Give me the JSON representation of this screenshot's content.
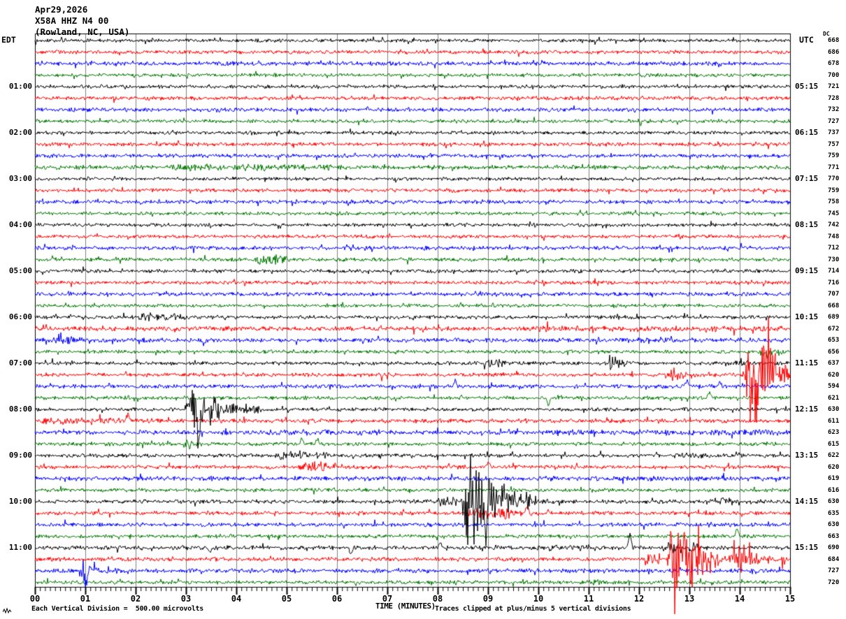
{
  "title": {
    "date": "Apr29,2026",
    "station": "X58A HHZ N4 00",
    "location": "(Rowland, NC, USA)"
  },
  "axes": {
    "left_header": "EDT",
    "right_header": "UTC",
    "dc_header": "DC",
    "x_title": "TIME (MINUTES)",
    "x_tick_labels": [
      "00",
      "01",
      "02",
      "03",
      "04",
      "05",
      "06",
      "07",
      "08",
      "09",
      "10",
      "11",
      "12",
      "13",
      "14",
      "15"
    ]
  },
  "footer": {
    "left": "Each Vertical Division =  500.00 microvolts",
    "right": "Traces clipped at plus/minus 5 vertical divisions"
  },
  "colors": {
    "trace_cycle": [
      "#000000",
      "#ff0000",
      "#0000ff",
      "#007700"
    ],
    "grid": "#808080",
    "border": "#000000",
    "background": "#ffffff"
  },
  "chart_data": {
    "type": "line",
    "x_range_minutes": [
      0,
      15
    ],
    "minutes_per_row": 15,
    "clip_divisions": 5,
    "microvolts_per_division": 500,
    "rows": [
      {
        "edt": "",
        "utc": "",
        "dc": 668,
        "amp": 1.7,
        "events": []
      },
      {
        "edt": "",
        "utc": "",
        "dc": 686,
        "amp": 1.8,
        "events": []
      },
      {
        "edt": "",
        "utc": "",
        "dc": 678,
        "amp": 2.0,
        "events": []
      },
      {
        "edt": "",
        "utc": "",
        "dc": 700,
        "amp": 1.8,
        "events": []
      },
      {
        "edt": "01:00",
        "utc": "05:15",
        "dc": 721,
        "amp": 1.7,
        "events": []
      },
      {
        "edt": "",
        "utc": "",
        "dc": 728,
        "amp": 1.9,
        "events": []
      },
      {
        "edt": "",
        "utc": "",
        "dc": 732,
        "amp": 2.0,
        "events": []
      },
      {
        "edt": "",
        "utc": "",
        "dc": 727,
        "amp": 1.8,
        "events": []
      },
      {
        "edt": "02:00",
        "utc": "06:15",
        "dc": 737,
        "amp": 1.7,
        "events": []
      },
      {
        "edt": "",
        "utc": "",
        "dc": 757,
        "amp": 1.8,
        "events": []
      },
      {
        "edt": "",
        "utc": "",
        "dc": 759,
        "amp": 1.9,
        "events": []
      },
      {
        "edt": "",
        "utc": "",
        "dc": 771,
        "amp": 2.2,
        "events": [
          [
            2.6,
            6.4,
            3.4,
            "noise"
          ]
        ]
      },
      {
        "edt": "03:00",
        "utc": "07:15",
        "dc": 770,
        "amp": 1.7,
        "events": []
      },
      {
        "edt": "",
        "utc": "",
        "dc": 759,
        "amp": 1.8,
        "events": []
      },
      {
        "edt": "",
        "utc": "",
        "dc": 758,
        "amp": 1.9,
        "events": []
      },
      {
        "edt": "",
        "utc": "",
        "dc": 745,
        "amp": 1.7,
        "events": []
      },
      {
        "edt": "04:00",
        "utc": "08:15",
        "dc": 742,
        "amp": 1.7,
        "events": []
      },
      {
        "edt": "",
        "utc": "",
        "dc": 748,
        "amp": 1.8,
        "events": []
      },
      {
        "edt": "",
        "utc": "",
        "dc": 712,
        "amp": 1.9,
        "events": []
      },
      {
        "edt": "",
        "utc": "",
        "dc": 730,
        "amp": 1.8,
        "events": [
          [
            4.3,
            5.1,
            5,
            "noise"
          ]
        ]
      },
      {
        "edt": "05:00",
        "utc": "09:15",
        "dc": 714,
        "amp": 1.7,
        "events": []
      },
      {
        "edt": "",
        "utc": "",
        "dc": 716,
        "amp": 1.8,
        "events": []
      },
      {
        "edt": "",
        "utc": "",
        "dc": 707,
        "amp": 1.9,
        "events": []
      },
      {
        "edt": "",
        "utc": "",
        "dc": 668,
        "amp": 1.7,
        "events": []
      },
      {
        "edt": "06:00",
        "utc": "10:15",
        "dc": 689,
        "amp": 1.8,
        "events": [
          [
            2.0,
            3.05,
            4.5,
            "noise"
          ]
        ]
      },
      {
        "edt": "",
        "utc": "",
        "dc": 672,
        "amp": 2.2,
        "events": [
          [
            9.5,
            15,
            3,
            "noise"
          ]
        ]
      },
      {
        "edt": "",
        "utc": "",
        "dc": 653,
        "amp": 2.2,
        "events": [
          [
            0.3,
            1.1,
            4,
            "noise"
          ],
          [
            3.35,
            3.35,
            -7,
            "spike"
          ]
        ]
      },
      {
        "edt": "",
        "utc": "",
        "dc": 656,
        "amp": 1.7,
        "events": [
          [
            14.3,
            15,
            4,
            "noise"
          ]
        ]
      },
      {
        "edt": "07:00",
        "utc": "11:15",
        "dc": 637,
        "amp": 1.8,
        "events": [
          [
            8.85,
            9.75,
            6,
            "burst"
          ],
          [
            11.35,
            11.95,
            9,
            "burst"
          ],
          [
            13.8,
            14.3,
            3,
            "noise"
          ]
        ]
      },
      {
        "edt": "",
        "utc": "",
        "dc": 620,
        "amp": 1.8,
        "events": [
          [
            6.8,
            7.3,
            6,
            "burst"
          ],
          [
            12.55,
            13.3,
            9,
            "burst"
          ],
          [
            14.05,
            15,
            60,
            "burst"
          ]
        ]
      },
      {
        "edt": "",
        "utc": "",
        "dc": 594,
        "amp": 2.0,
        "events": [
          [
            8.35,
            8.35,
            8,
            "spike"
          ],
          [
            12.95,
            12.95,
            9,
            "spike"
          ],
          [
            13.6,
            13.6,
            7,
            "spike"
          ]
        ]
      },
      {
        "edt": "",
        "utc": "",
        "dc": 621,
        "amp": 1.8,
        "events": [
          [
            10.2,
            10.2,
            -12,
            "spike"
          ],
          [
            13.4,
            13.4,
            10,
            "spike"
          ]
        ]
      },
      {
        "edt": "08:00",
        "utc": "12:15",
        "dc": 630,
        "amp": 1.8,
        "events": [
          [
            2.95,
            4.05,
            28,
            "burst"
          ],
          [
            3.25,
            3.25,
            -48,
            "spike"
          ],
          [
            4.05,
            4.6,
            5,
            "noise"
          ]
        ]
      },
      {
        "edt": "",
        "utc": "",
        "dc": 611,
        "amp": 2.0,
        "events": [
          [
            0,
            1.9,
            3.5,
            "noise"
          ],
          [
            1.85,
            1.85,
            9,
            "spike"
          ]
        ]
      },
      {
        "edt": "",
        "utc": "",
        "dc": 623,
        "amp": 2.2,
        "events": [
          [
            4.5,
            7.2,
            2.8,
            "noise"
          ],
          [
            10.5,
            15,
            2.8,
            "noise"
          ]
        ]
      },
      {
        "edt": "",
        "utc": "",
        "dc": 615,
        "amp": 1.8,
        "events": [
          [
            2.9,
            3.45,
            7,
            "burst"
          ],
          [
            5.3,
            5.3,
            8,
            "spike"
          ],
          [
            5.6,
            5.6,
            6,
            "spike"
          ]
        ]
      },
      {
        "edt": "09:00",
        "utc": "13:15",
        "dc": 622,
        "amp": 1.9,
        "events": [
          [
            4.65,
            5.95,
            4.5,
            "noise"
          ],
          [
            12.6,
            13.4,
            3,
            "noise"
          ]
        ]
      },
      {
        "edt": "",
        "utc": "",
        "dc": 620,
        "amp": 1.9,
        "events": [
          [
            5.15,
            6.05,
            5.5,
            "noise"
          ],
          [
            9.0,
            9.0,
            6,
            "spike"
          ]
        ]
      },
      {
        "edt": "",
        "utc": "",
        "dc": 619,
        "amp": 2.3,
        "events": []
      },
      {
        "edt": "",
        "utc": "",
        "dc": 616,
        "amp": 1.8,
        "events": []
      },
      {
        "edt": "10:00",
        "utc": "14:15",
        "dc": 630,
        "amp": 1.9,
        "events": [
          [
            7.9,
            8.45,
            5,
            "noise"
          ],
          [
            8.45,
            9.55,
            65,
            "burst"
          ],
          [
            8.95,
            8.95,
            -75,
            "spike"
          ],
          [
            9.55,
            10.4,
            10,
            "burst"
          ],
          [
            13.5,
            13.95,
            4,
            "noise"
          ]
        ]
      },
      {
        "edt": "",
        "utc": "",
        "dc": 635,
        "amp": 1.9,
        "events": [
          [
            8.5,
            9.6,
            6,
            "noise"
          ],
          [
            9.78,
            9.78,
            11,
            "spike"
          ]
        ]
      },
      {
        "edt": "",
        "utc": "",
        "dc": 630,
        "amp": 1.9,
        "events": []
      },
      {
        "edt": "",
        "utc": "",
        "dc": 663,
        "amp": 1.8,
        "events": [
          [
            13.95,
            13.95,
            12,
            "spike"
          ]
        ]
      },
      {
        "edt": "11:00",
        "utc": "15:15",
        "dc": 690,
        "amp": 2.0,
        "events": [
          [
            3.48,
            3.48,
            -8,
            "spike"
          ],
          [
            6.28,
            6.28,
            -10,
            "spike"
          ],
          [
            8.05,
            8.05,
            8,
            "spike"
          ],
          [
            9.9,
            11.3,
            3,
            "noise"
          ],
          [
            11.82,
            11.82,
            22,
            "spike"
          ],
          [
            12.5,
            13.3,
            5,
            "noise"
          ]
        ]
      },
      {
        "edt": "",
        "utc": "",
        "dc": 684,
        "amp": 2.0,
        "events": [
          [
            1.4,
            2.0,
            3,
            "noise"
          ],
          [
            12.0,
            12.55,
            6,
            "noise"
          ],
          [
            12.55,
            13.35,
            78,
            "burst"
          ],
          [
            13.75,
            14.75,
            18,
            "burst"
          ],
          [
            14.75,
            15,
            7,
            "noise"
          ]
        ]
      },
      {
        "edt": "",
        "utc": "",
        "dc": 727,
        "amp": 2.0,
        "events": [
          [
            0.85,
            1.35,
            12,
            "burst"
          ],
          [
            1.02,
            1.02,
            -26,
            "spike"
          ],
          [
            1.35,
            2.0,
            3.5,
            "noise"
          ]
        ]
      },
      {
        "edt": "",
        "utc": "",
        "dc": 720,
        "amp": 1.8,
        "events": [
          [
            10.9,
            12.0,
            2.6,
            "noise"
          ]
        ]
      }
    ]
  }
}
